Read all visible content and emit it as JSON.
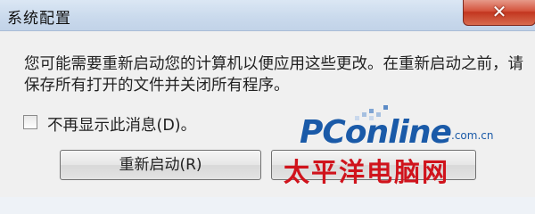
{
  "window": {
    "title": "系统配置",
    "close_icon": "close-icon"
  },
  "message": "您可能需要重新启动您的计算机以便应用这些更改。在重新启动之前，请保存所有打开的文件并关闭所有程序。",
  "checkbox": {
    "label": "不再显示此消息(D)。",
    "checked": false
  },
  "buttons": {
    "restart_label": "重新启动(R)"
  },
  "watermark": {
    "brand": "PConline",
    "domain": ".com.cn",
    "cn_name": "太平洋电脑网",
    "colors": {
      "brand_blue": "#1a5aa8",
      "cn_red": "#d0131c"
    }
  }
}
